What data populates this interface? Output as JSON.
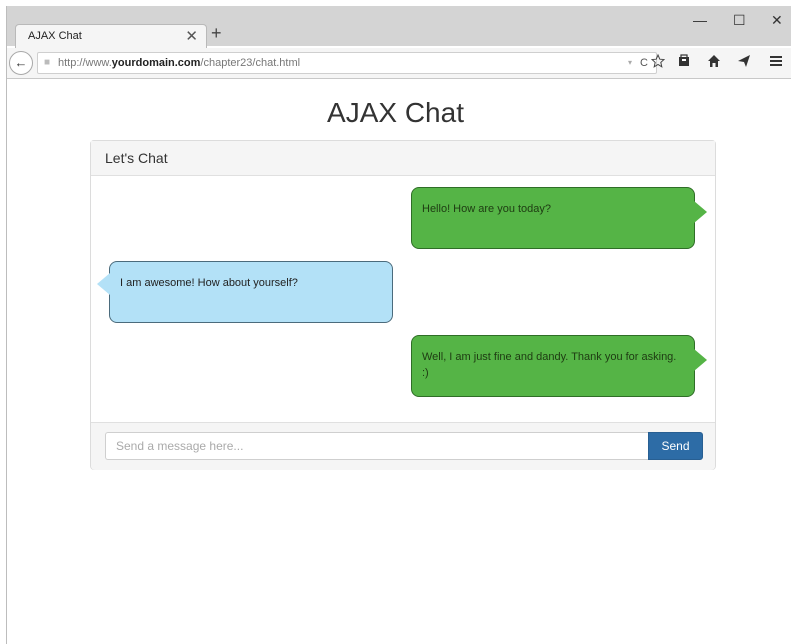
{
  "browser": {
    "tab_title": "AJAX Chat",
    "tab_close": "✕",
    "new_tab": "+",
    "url_prefix": "http://www.",
    "url_domain": "yourdomain.com",
    "url_path": "/chapter23/chat.html",
    "reload": "C",
    "dropdown": "▾",
    "minimize": "—",
    "maximize": "☐",
    "close": "✕",
    "back": "←",
    "bookmark_icon": "star-icon",
    "library_icon": "library-icon",
    "home_icon": "home-icon",
    "send_icon": "send-icon",
    "menu_icon": "hamburger-icon"
  },
  "page": {
    "title": "AJAX Chat"
  },
  "panel": {
    "heading": "Let's Chat",
    "messages": [
      {
        "side": "sent",
        "text": "Hello! How are you today?"
      },
      {
        "side": "received",
        "text": "I am awesome! How about yourself?"
      },
      {
        "side": "sent",
        "text": "Well, I am just fine and dandy. Thank you for asking. :)"
      }
    ],
    "input_placeholder": "Send a message here...",
    "input_value": "",
    "send_label": "Send"
  },
  "colors": {
    "sent_bubble": "#55b446",
    "received_bubble": "#b3e1f7",
    "send_button": "#2d6ca6"
  }
}
